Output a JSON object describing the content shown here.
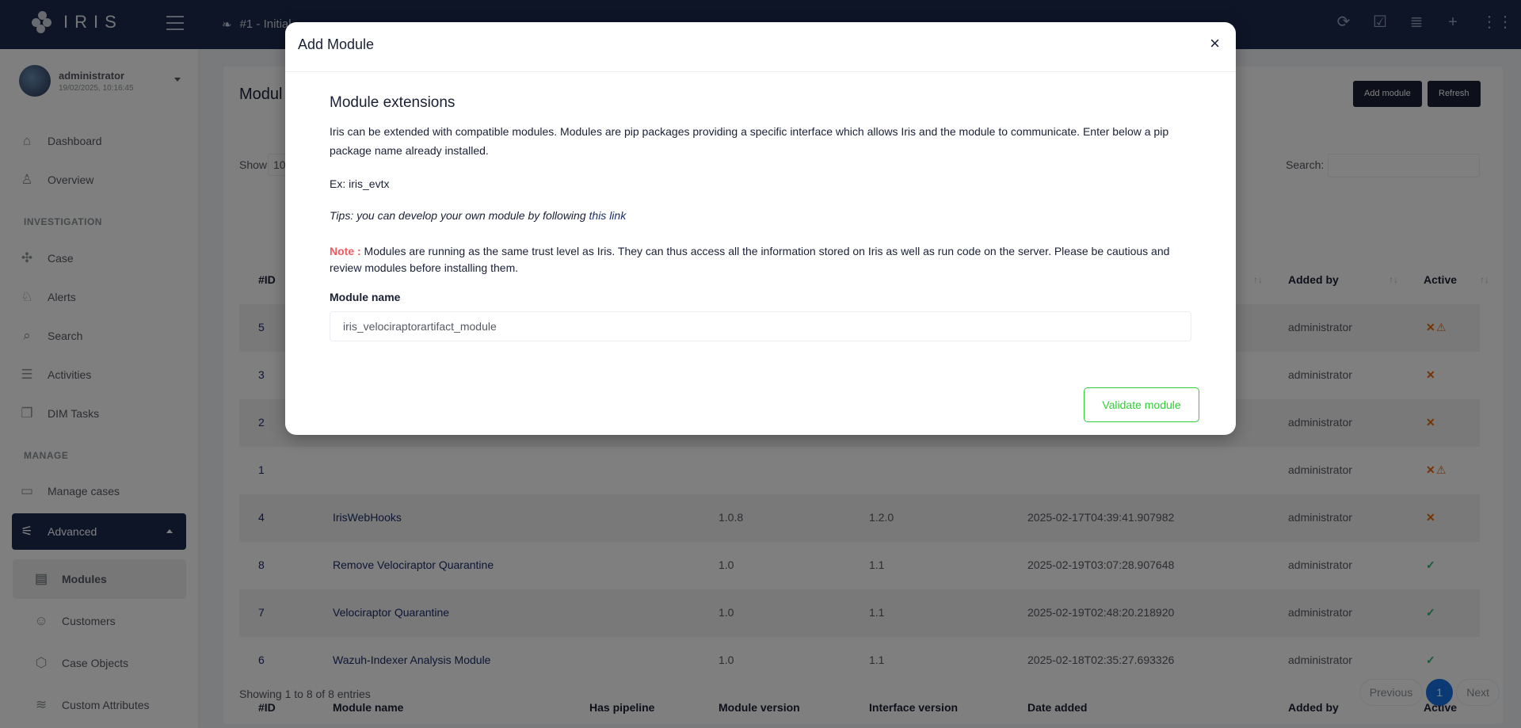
{
  "topbar": {
    "app_name": "IRIS",
    "case_title": "#1 - Initial"
  },
  "user": {
    "name": "administrator",
    "datetime": "19/02/2025, 10:16:45"
  },
  "nav": {
    "dashboard": "Dashboard",
    "overview": "Overview",
    "section_investigation": "INVESTIGATION",
    "case": "Case",
    "alerts": "Alerts",
    "search": "Search",
    "activities": "Activities",
    "dim_tasks": "DIM Tasks",
    "section_manage": "MANAGE",
    "manage_cases": "Manage cases",
    "advanced": "Advanced",
    "modules": "Modules",
    "customers": "Customers",
    "case_objects": "Case Objects",
    "custom_attributes": "Custom Attributes"
  },
  "card": {
    "title": "Modul",
    "add_module_label": "Add module",
    "refresh_label": "Refresh",
    "show_label": "Show",
    "show_value": "10",
    "search_label": "Search:"
  },
  "table": {
    "headers": {
      "id": "#ID",
      "module_name": "Module name",
      "has_pipeline": "Has pipeline",
      "module_version": "Module version",
      "interface_version": "Interface version",
      "date_added": "Date added",
      "added_by": "Added by",
      "active": "Active"
    },
    "rows": [
      {
        "id": "5",
        "name": "",
        "version": "",
        "interface": "",
        "date": "",
        "added_by": "administrator",
        "active": "✕",
        "warn": "⚠"
      },
      {
        "id": "3",
        "name": "",
        "version": "",
        "interface": "",
        "date": "",
        "added_by": "administrator",
        "active": "✕",
        "warn": ""
      },
      {
        "id": "2",
        "name": "",
        "version": "",
        "interface": "",
        "date": "",
        "added_by": "administrator",
        "active": "✕",
        "warn": ""
      },
      {
        "id": "1",
        "name": "",
        "version": "",
        "interface": "",
        "date": "",
        "added_by": "administrator",
        "active": "✕",
        "warn": "⚠"
      },
      {
        "id": "4",
        "name": "IrisWebHooks",
        "version": "1.0.8",
        "interface": "1.2.0",
        "date": "2025-02-17T04:39:41.907982",
        "added_by": "administrator",
        "active": "✕",
        "warn": ""
      },
      {
        "id": "8",
        "name": "Remove Velociraptor Quarantine",
        "version": "1.0",
        "interface": "1.1",
        "date": "2025-02-19T03:07:28.907648",
        "added_by": "administrator",
        "active": "✓",
        "warn": ""
      },
      {
        "id": "7",
        "name": "Velociraptor Quarantine",
        "version": "1.0",
        "interface": "1.1",
        "date": "2025-02-19T02:48:20.218920",
        "added_by": "administrator",
        "active": "✓",
        "warn": ""
      },
      {
        "id": "6",
        "name": "Wazuh-Indexer Analysis Module",
        "version": "1.0",
        "interface": "1.1",
        "date": "2025-02-18T02:35:27.693326",
        "added_by": "administrator",
        "active": "✓",
        "warn": ""
      }
    ],
    "footer_info": "Showing 1 to 8 of 8 entries",
    "pager": {
      "previous": "Previous",
      "page": "1",
      "next": "Next"
    }
  },
  "modal": {
    "title": "Add Module",
    "close": "×",
    "heading": "Module extensions",
    "description": "Iris can be extended with compatible modules. Modules are pip packages providing a specific interface which allows Iris and the module to communicate. Enter below a pip package name already installed.",
    "example": "Ex: iris_evtx",
    "tips_text": "Tips: you can develop your own module by following ",
    "tips_link": "this link",
    "note_label": "Note :",
    "note_text": " Modules are running as the same trust level as Iris. They can thus access all the information stored on Iris as well as run code on the server. Please be cautious and review modules before installing them.",
    "field_label": "Module name",
    "field_value": "iris_velociraptorartifact_module",
    "validate_label": "Validate module"
  },
  "colors": {
    "topbar": "#1b2b4f",
    "accent_blue": "#1572e8",
    "success": "#31ce36",
    "danger": "#f25961",
    "warning": "#e8690b"
  },
  "icons": [
    "logo-icon",
    "menu-icon",
    "case-leaf-icon",
    "sync-icon",
    "checkbox-icon",
    "database-icon",
    "plus-icon",
    "apps-grid-icon",
    "home-icon",
    "overview-icon",
    "case-icon",
    "alerts-icon",
    "search-icon",
    "activities-icon",
    "tasks-icon",
    "folder-icon",
    "advanced-icon",
    "modules-icon",
    "customers-icon",
    "case-objects-icon",
    "custom-attributes-icon"
  ]
}
